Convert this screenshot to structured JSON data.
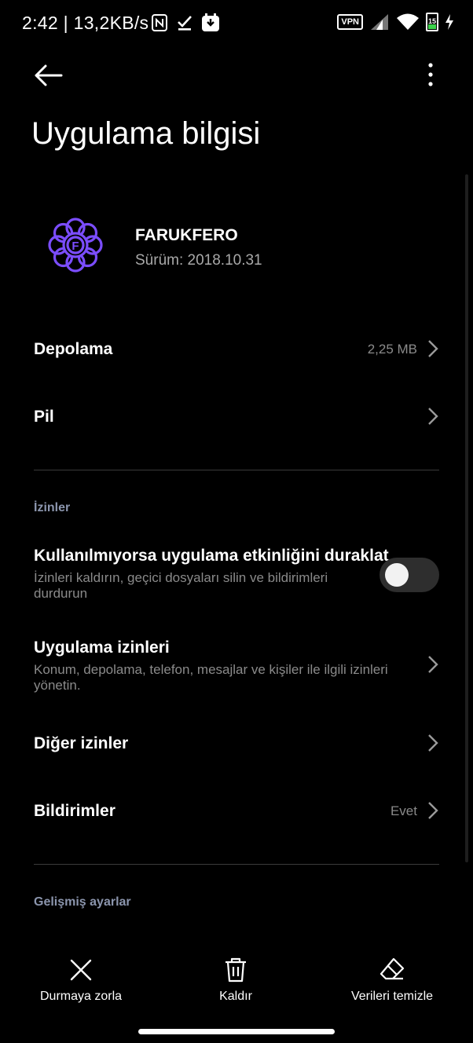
{
  "status_bar": {
    "time": "2:42 | 13,2KB/s",
    "vpn": "VPN",
    "battery_level": "15"
  },
  "page": {
    "title": "Uygulama bilgisi"
  },
  "app": {
    "name": "FARUKFERO",
    "version": "Sürüm: 2018.10.31",
    "icon_letter": "F",
    "accent_color": "#7b4dff"
  },
  "rows": {
    "storage": {
      "title": "Depolama",
      "value": "2,25 MB"
    },
    "battery": {
      "title": "Pil"
    },
    "pause_app": {
      "title": "Kullanılmıyorsa uygulama etkinliğini duraklat",
      "subtitle": "İzinleri kaldırın, geçici dosyaları silin ve bildirimleri durdurun",
      "enabled": false
    },
    "app_permissions": {
      "title": "Uygulama izinleri",
      "subtitle": "Konum, depolama, telefon, mesajlar ve kişiler ile ilgili izinleri yönetin."
    },
    "other_permissions": {
      "title": "Diğer izinler"
    },
    "notifications": {
      "title": "Bildirimler",
      "value": "Evet"
    }
  },
  "sections": {
    "permissions": "İzinler",
    "advanced": "Gelişmiş ayarlar"
  },
  "bottom_actions": {
    "force_stop": "Durmaya zorla",
    "uninstall": "Kaldır",
    "clear_data": "Verileri temizle"
  },
  "colors": {
    "background": "#000000",
    "section_label": "#8b95ad",
    "secondary_text": "#8a8a8a"
  }
}
